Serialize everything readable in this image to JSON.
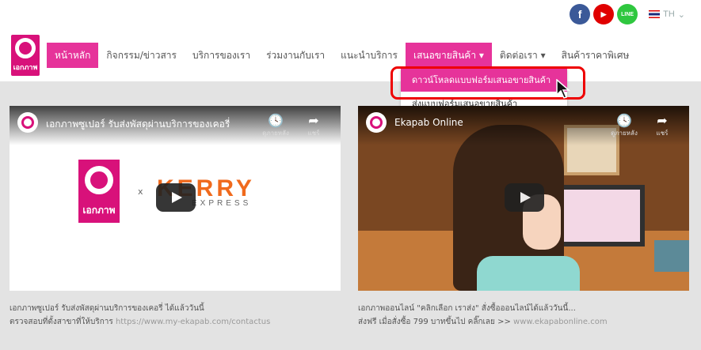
{
  "colors": {
    "accent": "#e6339a",
    "brand": "#d8117a",
    "annotation": "#ee0000"
  },
  "social": {
    "facebook_glyph": "f",
    "youtube_glyph": "▶",
    "line_label": "LINE",
    "lang_label": "TH"
  },
  "logo": {
    "text": "เอกภาพ"
  },
  "nav": {
    "items": [
      {
        "label": "หน้าหลัก"
      },
      {
        "label": "กิจกรรม/ข่าวสาร"
      },
      {
        "label": "บริการของเรา"
      },
      {
        "label": "ร่วมงานกับเรา"
      },
      {
        "label": "แนะนำบริการ"
      },
      {
        "label": "เสนอขายสินค้า ▾"
      },
      {
        "label": "ติดต่อเรา ▾"
      },
      {
        "label": "สินค้าราคาพิเศษ"
      }
    ]
  },
  "dropdown": {
    "items": [
      {
        "label": "ดาวน์โหลดแบบฟอร์มเสนอขายสินค้า"
      },
      {
        "label": "ส่งแบบฟอร์มเสนอขายสินค้า"
      }
    ]
  },
  "videos": [
    {
      "title": "เอกภาพซูเปอร์ รับส่งพัสดุผ่านบริการของเคอรี่",
      "watch_later": "ดูภายหลัง",
      "share": "แชร์",
      "logo_text": "เอกภาพ",
      "x_mark": "x",
      "kerry": "KERRY",
      "express": "EXPRESS"
    },
    {
      "title": "Ekapab Online",
      "watch_later": "ดูภายหลัง",
      "share": "แชร์"
    }
  ],
  "captions": [
    {
      "line1": "เอกภาพซูเปอร์ รับส่งพัสดุผ่านบริการของเคอรี่ ได้แล้ววันนี้",
      "line2_prefix": "ตรวจสอบที่ตั้งสาขาที่ให้บริการ ",
      "line2_link": "https://www.my-ekapab.com/contactus"
    },
    {
      "line1": "เอกภาพออนไลน์ \"คลิกเลือก เราส่ง\" สั่งซื้อออนไลน์ได้แล้ววันนี้...",
      "line2_prefix": "ส่งฟรี เมื่อสั่งซื้อ 799 บาทขึ้นไป   คลิ๊กเลย >> ",
      "line2_link": "www.ekapabonline.com"
    }
  ]
}
